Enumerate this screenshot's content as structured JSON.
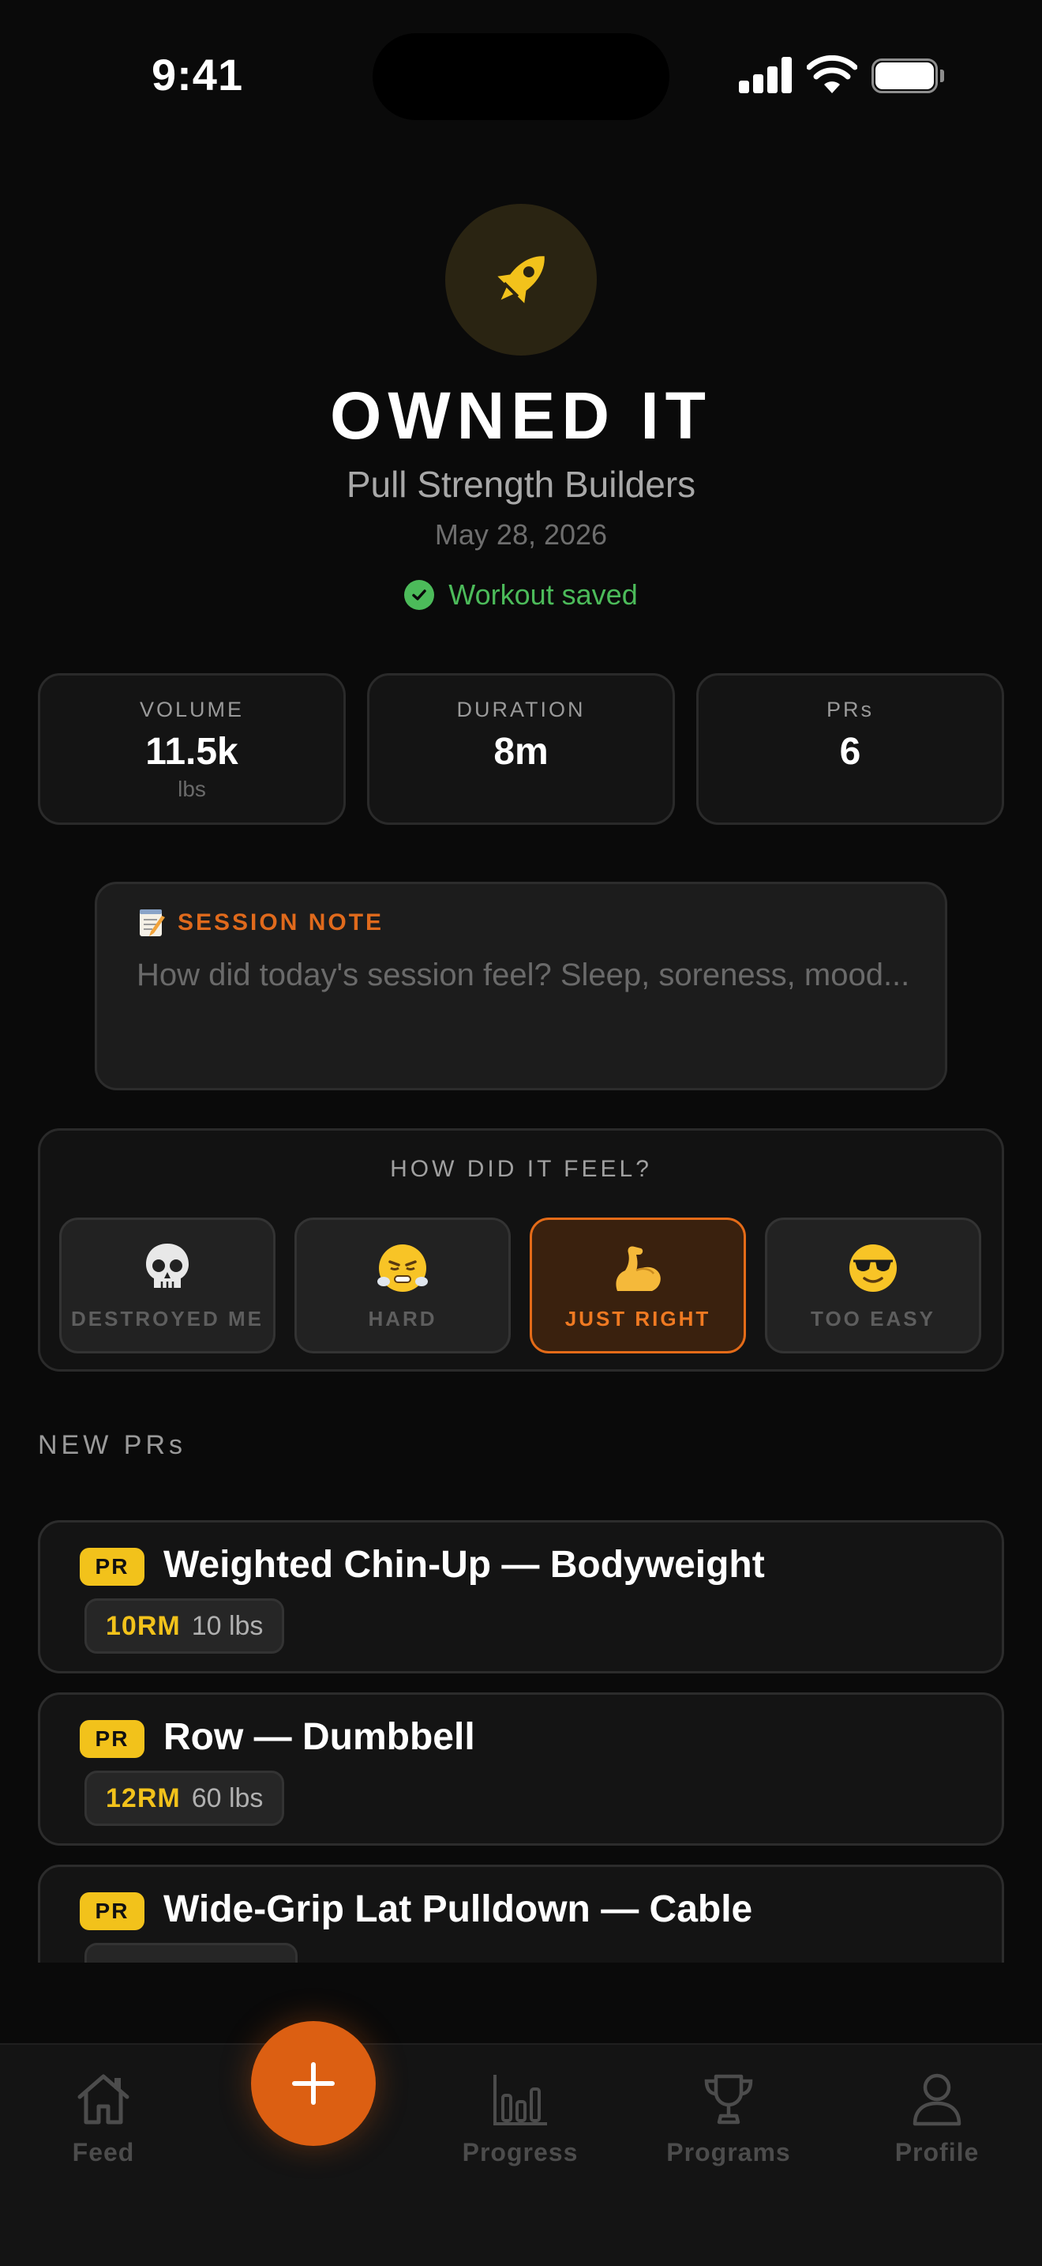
{
  "status_bar": {
    "time": "9:41"
  },
  "hero": {
    "icon": "rocket-icon",
    "title": "OWNED IT",
    "subtitle": "Pull Strength Builders",
    "date": "May 28, 2026",
    "saved_text": "Workout saved"
  },
  "stats": [
    {
      "label": "VOLUME",
      "value": "11.5k",
      "unit": "lbs"
    },
    {
      "label": "DURATION",
      "value": "8m",
      "unit": ""
    },
    {
      "label": "PRs",
      "value": "6",
      "unit": ""
    }
  ],
  "session_note": {
    "icon": "memo-icon",
    "label": "SESSION NOTE",
    "placeholder": "How did today's session feel? Sleep, soreness, mood..."
  },
  "feel": {
    "title": "HOW DID IT FEEL?",
    "options": [
      {
        "emoji": "💀",
        "icon": "skull-icon",
        "label": "DESTROYED ME",
        "selected": false
      },
      {
        "emoji": "😤",
        "icon": "steam-face-icon",
        "label": "HARD",
        "selected": false
      },
      {
        "emoji": "💪",
        "icon": "flexed-biceps-icon",
        "label": "JUST RIGHT",
        "selected": true
      },
      {
        "emoji": "😎",
        "icon": "sunglasses-face-icon",
        "label": "TOO EASY",
        "selected": false
      }
    ]
  },
  "new_prs": {
    "title": "NEW PRs",
    "items": [
      {
        "badge": "PR",
        "name": "Weighted Chin-Up — Bodyweight",
        "rm": "10RM",
        "weight": "10 lbs"
      },
      {
        "badge": "PR",
        "name": "Row — Dumbbell",
        "rm": "12RM",
        "weight": "60 lbs"
      },
      {
        "badge": "PR",
        "name": "Wide-Grip Lat Pulldown — Cable",
        "rm": "",
        "weight": ""
      }
    ]
  },
  "tabbar": {
    "tabs": [
      {
        "label": "Feed",
        "icon": "home-icon"
      },
      {
        "label": "Progress",
        "icon": "bar-chart-icon"
      },
      {
        "label": "Programs",
        "icon": "trophy-icon"
      },
      {
        "label": "Profile",
        "icon": "person-icon"
      }
    ],
    "fab_icon": "plus-icon"
  },
  "colors": {
    "accent_orange": "#dc5f12",
    "gold": "#f2c21b",
    "success_green": "#4cbb5a",
    "background": "#0a0a0a"
  }
}
